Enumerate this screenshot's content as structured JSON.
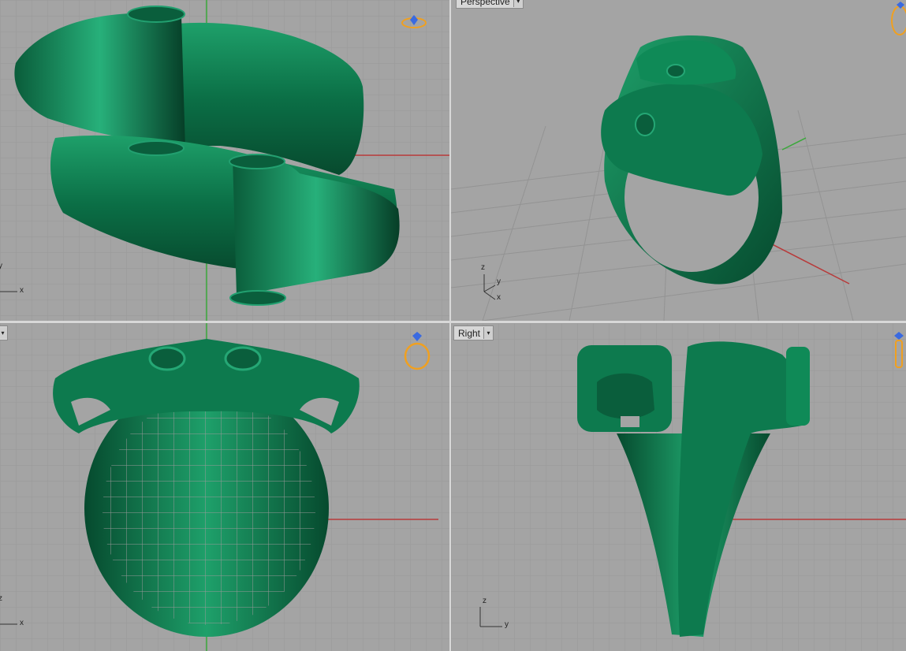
{
  "viewports": {
    "top": {
      "label": ""
    },
    "perspective": {
      "label": "Perspective"
    },
    "front": {
      "label": ""
    },
    "right": {
      "label": "Right"
    }
  },
  "axes": {
    "top": {
      "x": "x",
      "y": "y"
    },
    "persp": {
      "x": "x",
      "y": "y",
      "z": "z"
    },
    "front": {
      "x": "x",
      "z": "z"
    },
    "right": {
      "y": "y",
      "z": "z"
    }
  },
  "colors": {
    "viewport_bg": "#a4a4a4",
    "grid": "#9a9a9a",
    "model": "#0d7a4e",
    "x_axis": "#b83a3a",
    "y_axis": "#3aa83a",
    "icon": "#f0a020",
    "icon_gem": "#3a6ae0"
  },
  "icons": [
    "ring-icon",
    "diamond-icon"
  ]
}
